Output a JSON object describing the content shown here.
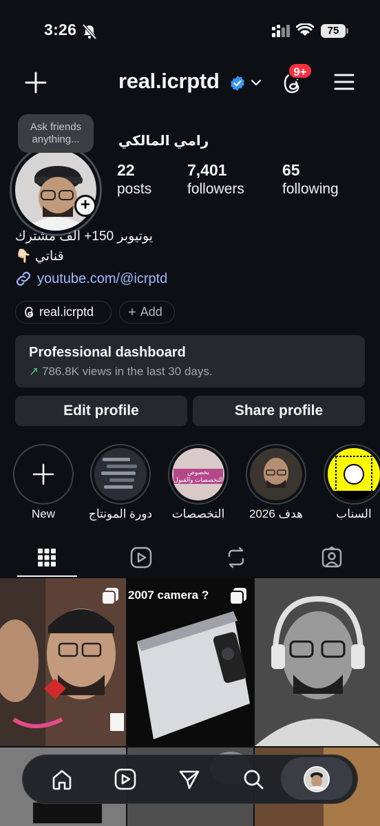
{
  "status_bar": {
    "time": "3:26",
    "battery": "75"
  },
  "header": {
    "username": "real.icrptd",
    "notification_count": "9+"
  },
  "profile": {
    "note": "Ask friends anything...",
    "display_name": "رامي المالكي",
    "stats": [
      {
        "value": "22",
        "label": "posts"
      },
      {
        "value": "7,401",
        "label": "followers"
      },
      {
        "value": "65",
        "label": "following"
      }
    ],
    "bio_line1": "يوتيوبر 150+ الف مشترك",
    "bio_line2": "قناتي 👇🏻",
    "link": "youtube.com/@icrptd",
    "threads_label": "real.icrptd",
    "add_label": "Add"
  },
  "dashboard": {
    "title": "Professional dashboard",
    "subtitle_arrow": "↗",
    "subtitle": "786.8K views in the last 30 days."
  },
  "buttons": {
    "edit": "Edit profile",
    "share": "Share profile"
  },
  "highlights": [
    {
      "label": "New"
    },
    {
      "label": "دورة المونتاج"
    },
    {
      "label": "التخصصات",
      "inner_text": "بخصوص التخصصات والقبول"
    },
    {
      "label": "هدف 2026"
    },
    {
      "label": "السناب"
    }
  ],
  "grid": {
    "post2_caption": "2007 camera ?"
  },
  "colors": {
    "background": "#0c1014",
    "verified": "#3897f0",
    "badge": "#ff3040",
    "link": "#a4b6ff",
    "card": "#25292e"
  },
  "icons": [
    "plus-icon",
    "verified-icon",
    "chevron-down-icon",
    "threads-icon",
    "menu-icon",
    "link-icon",
    "grid-icon",
    "reels-icon",
    "reposts-icon",
    "tagged-icon",
    "home-icon",
    "send-icon",
    "search-icon"
  ]
}
